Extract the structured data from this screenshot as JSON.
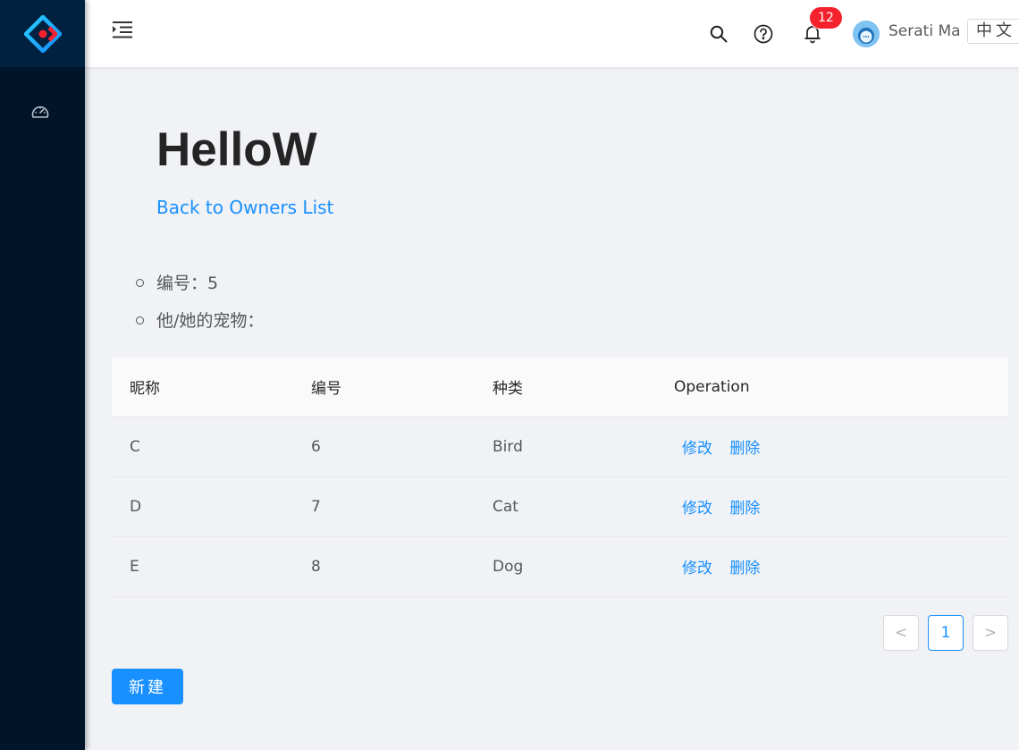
{
  "sidebar": {
    "logo_icon": "react-logo-icon",
    "menu_items": [
      {
        "icon": "dashboard-icon"
      }
    ]
  },
  "header": {
    "notification_count": "12",
    "user_name": "Serati Ma",
    "lang_label": "中文",
    "icons": [
      "menu-fold-icon",
      "search-icon",
      "question-circle-icon",
      "bell-icon"
    ]
  },
  "page": {
    "title": "HelloW",
    "back_link": "Back to Owners List",
    "info": [
      {
        "text": "编号：5"
      },
      {
        "text": "他/她的宠物："
      }
    ]
  },
  "table": {
    "columns": [
      "昵称",
      "编号",
      "种类",
      "Operation"
    ],
    "rows": [
      {
        "name": "C",
        "id": "6",
        "type": "Bird",
        "edit": "修改",
        "delete": "删除"
      },
      {
        "name": "D",
        "id": "7",
        "type": "Cat",
        "edit": "修改",
        "delete": "删除"
      },
      {
        "name": "E",
        "id": "8",
        "type": "Dog",
        "edit": "修改",
        "delete": "删除"
      }
    ]
  },
  "pagination": {
    "prev": "<",
    "current": "1",
    "next": ">"
  },
  "actions": {
    "new_label": "新建"
  },
  "colors": {
    "sidebar": "#001529",
    "primary": "#1890ff",
    "badge": "#f5222d",
    "background": "#f0f2f5"
  }
}
